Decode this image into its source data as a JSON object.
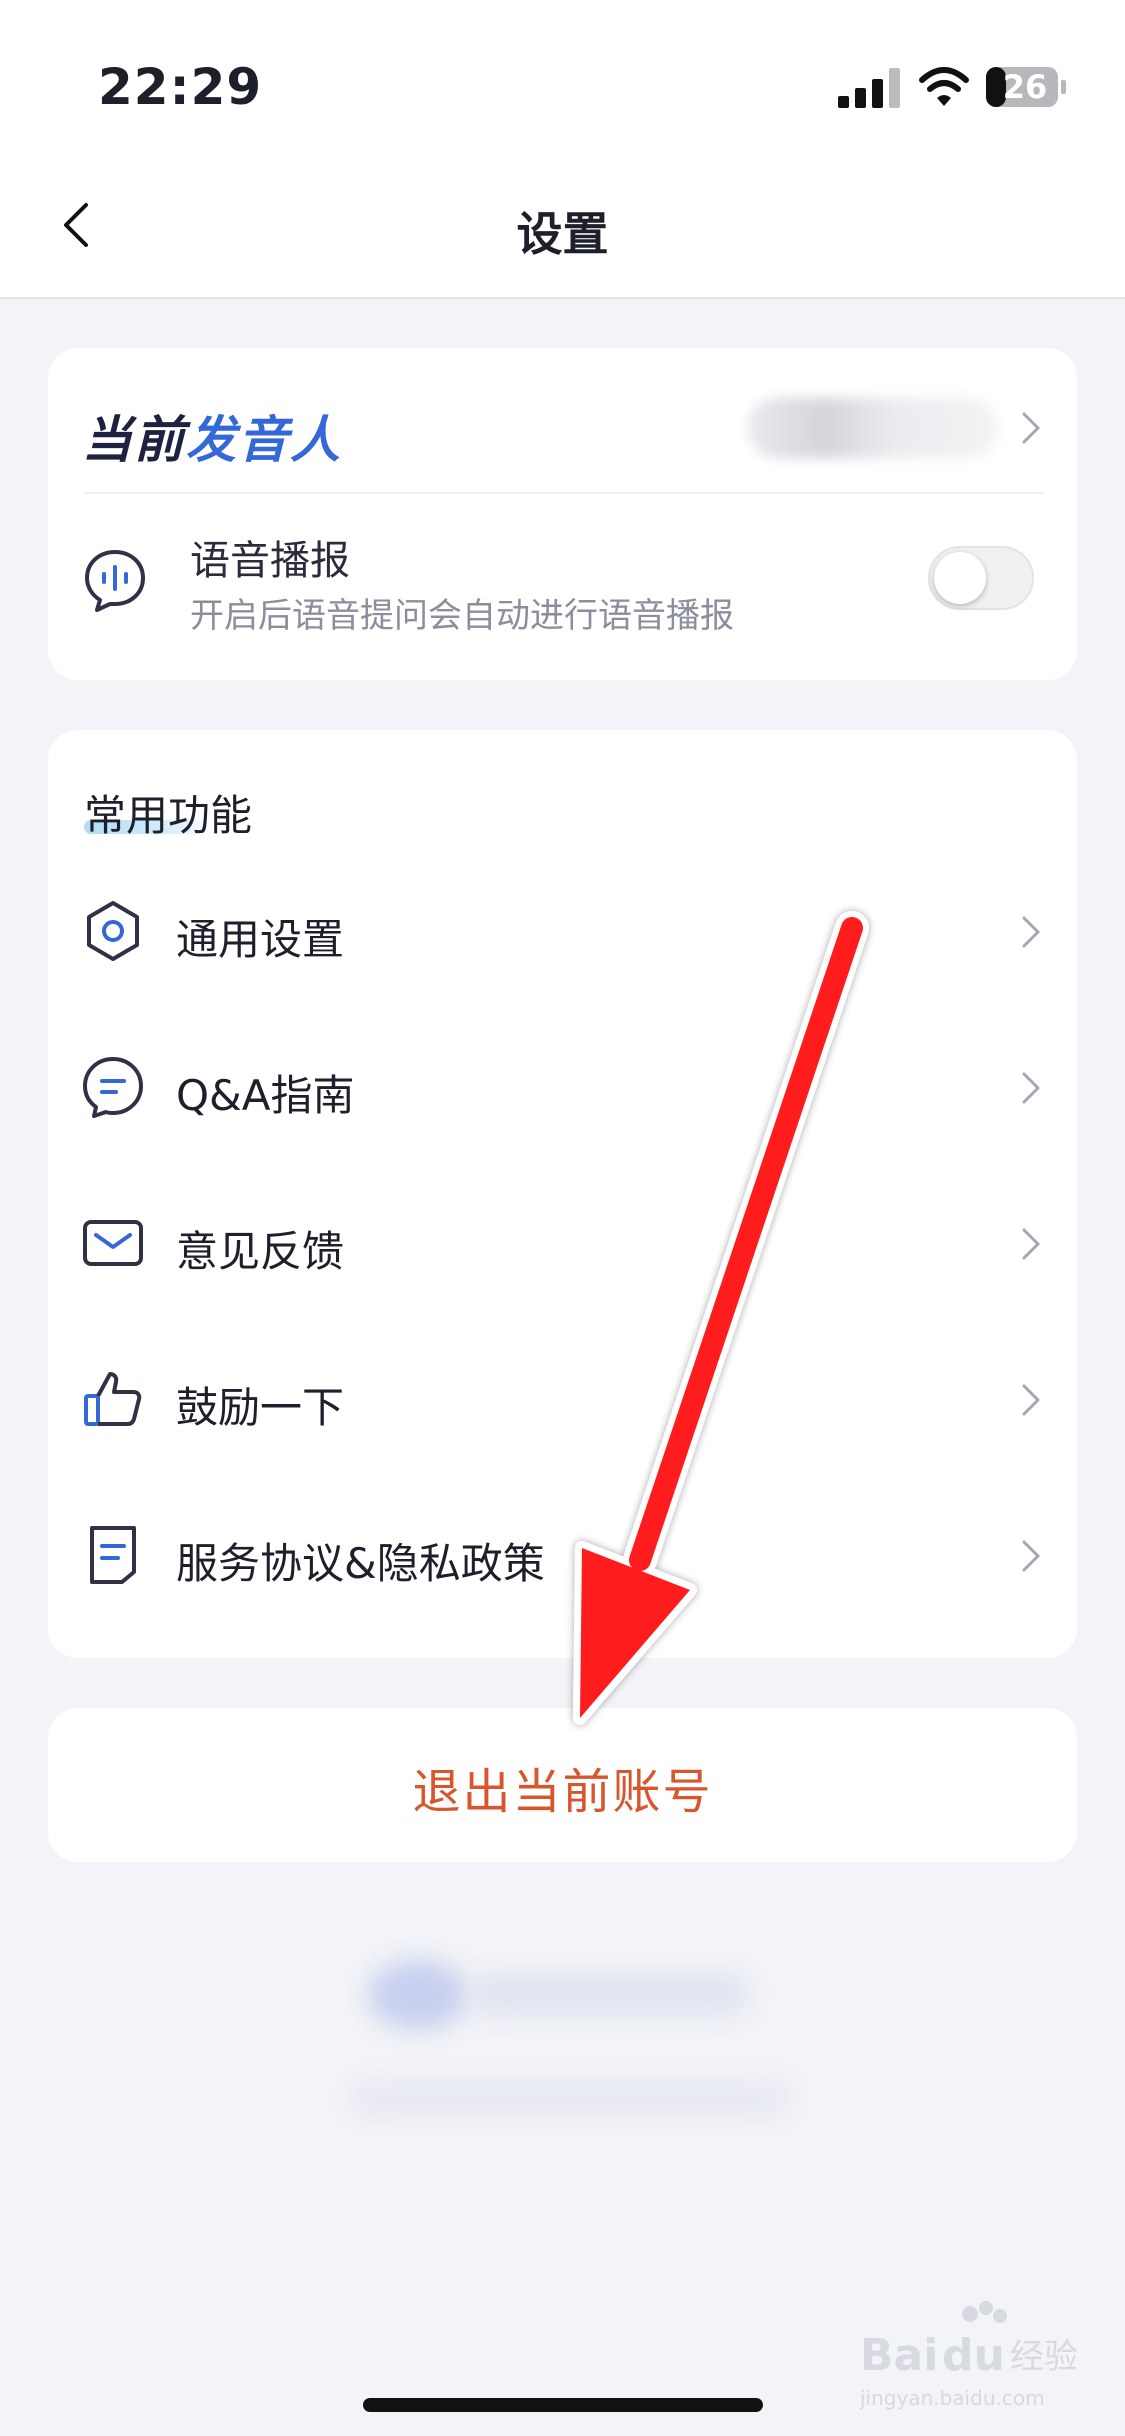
{
  "status_bar": {
    "time": "22:29",
    "battery": "26"
  },
  "nav": {
    "title": "设置"
  },
  "speaker": {
    "title_part1": "当前",
    "title_part2": "发音人"
  },
  "voice_broadcast": {
    "label": "语音播报",
    "description": "开启后语音提问会自动进行语音播报",
    "enabled": false
  },
  "common": {
    "title": "常用功能",
    "items": [
      {
        "label": "通用设置",
        "icon": "gear-icon"
      },
      {
        "label": "Q&A指南",
        "icon": "chat-bubble-icon"
      },
      {
        "label": "意见反馈",
        "icon": "envelope-icon"
      },
      {
        "label": "鼓励一下",
        "icon": "thumbs-up-icon"
      },
      {
        "label": "服务协议&隐私政策",
        "icon": "document-icon"
      }
    ]
  },
  "logout": {
    "label": "退出当前账号"
  },
  "colors": {
    "accent_blue": "#3468d8",
    "logout_red": "#d9562c",
    "arrow_red": "#ff1a1a"
  },
  "watermark": {
    "text": "jingyan.baidu.com"
  }
}
